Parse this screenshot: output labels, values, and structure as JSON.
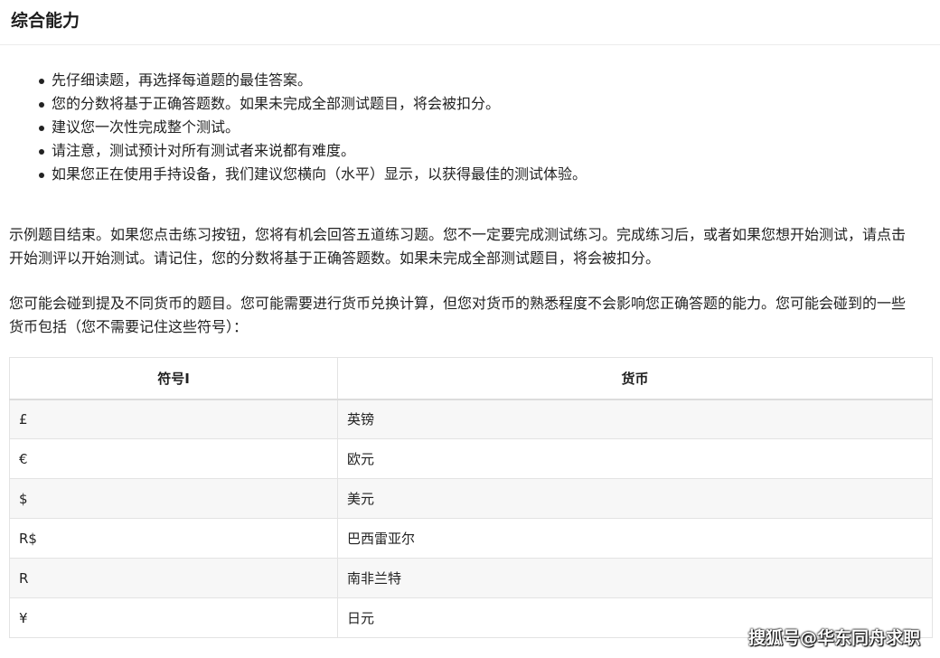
{
  "header": {
    "title": "综合能力"
  },
  "instructions": [
    "先仔细读题，再选择每道题的最佳答案。",
    "您的分数将基于正确答题数。如果未完成全部测试题目，将会被扣分。",
    "建议您一次性完成整个测试。",
    "请注意，测试预计对所有测试者来说都有难度。",
    "如果您正在使用手持设备，我们建议您横向（水平）显示，以获得最佳的测试体验。"
  ],
  "paragraphs": {
    "practice_note": "示例题目结束。如果您点击练习按钮，您将有机会回答五道练习题。您不一定要完成测试练习。完成练习后，或者如果您想开始测试，请点击开始测评以开始测试。请记住，您的分数将基于正确答题数。如果未完成全部测试题目，将会被扣分。",
    "currency_note": "您可能会碰到提及不同货币的题目。您可能需要进行货币兑换计算，但您对货币的熟悉程度不会影响您正确答题的能力。您可能会碰到的一些货币包括（您不需要记住这些符号）："
  },
  "currency_table": {
    "headers": [
      "符号I",
      "货币"
    ],
    "rows": [
      [
        "£",
        "英镑"
      ],
      [
        "€",
        "欧元"
      ],
      [
        "$",
        "美元"
      ],
      [
        "R$",
        "巴西雷亚尔"
      ],
      [
        "R",
        "南非兰特"
      ],
      [
        "¥",
        "日元"
      ]
    ]
  },
  "watermark": "搜狐号@华东同舟求职"
}
